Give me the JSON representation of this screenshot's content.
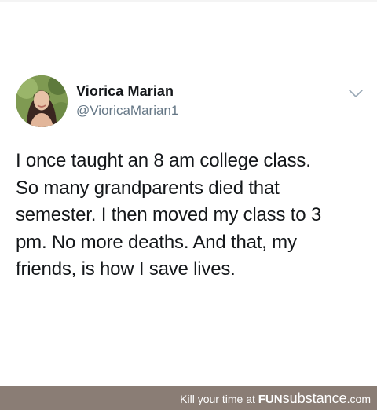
{
  "tweet": {
    "author_name": "Viorica Marian",
    "author_handle": "@VioricaMarian1",
    "menu_icon": "chevron-down-icon",
    "lines": [
      "I once taught an 8 am college class.",
      "So many grandparents died that",
      "semester. I then moved my class to 3",
      "pm. No more deaths. And that, my",
      "friends, is how I save lives."
    ]
  },
  "watermark": {
    "prefix": "Kill your time at ",
    "brand_bold": "FUN",
    "brand_light": "substance",
    "suffix": ".com",
    "background": "#8a7d75"
  },
  "colors": {
    "name": "#14171a",
    "handle": "#657786",
    "text": "#14171a"
  }
}
